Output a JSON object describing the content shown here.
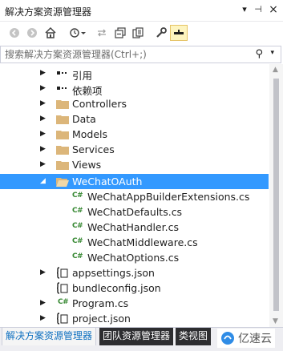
{
  "window": {
    "title": "解决方案资源管理器",
    "controls": {
      "dropdown": "▾",
      "pin": "⊣",
      "close": "×"
    }
  },
  "toolbar": {
    "buttons": [
      {
        "icon": "back-icon",
        "glyph": "◀"
      },
      {
        "icon": "forward-icon",
        "glyph": "▶"
      },
      {
        "icon": "home-icon",
        "glyph": "⌂"
      },
      {
        "icon": "history-icon",
        "glyph": "⏲"
      },
      {
        "icon": "sync-icon",
        "glyph": "⇆"
      },
      {
        "icon": "collapse-all-icon",
        "glyph": "❐"
      },
      {
        "icon": "copy-icon",
        "glyph": "⧉"
      },
      {
        "icon": "properties-icon",
        "glyph": "🔧"
      },
      {
        "icon": "preview-icon",
        "glyph": "▬"
      }
    ]
  },
  "search": {
    "placeholder": "搜索解决方案资源管理器(Ctrl+;)"
  },
  "tree": {
    "items": [
      {
        "label": "引用",
        "type": "references",
        "expander": "▶"
      },
      {
        "label": "依赖项",
        "type": "dependencies",
        "expander": "▶"
      },
      {
        "label": "Controllers",
        "type": "folder",
        "expander": "▶"
      },
      {
        "label": "Data",
        "type": "folder",
        "expander": "▶"
      },
      {
        "label": "Models",
        "type": "folder",
        "expander": "▶"
      },
      {
        "label": "Services",
        "type": "folder",
        "expander": "▶"
      },
      {
        "label": "Views",
        "type": "folder",
        "expander": "▶"
      },
      {
        "label": "WeChatOAuth",
        "type": "folder-open",
        "expander": "◢",
        "selected": true
      },
      {
        "label": "WeChatAppBuilderExtensions.cs",
        "type": "cs"
      },
      {
        "label": "WeChatDefaults.cs",
        "type": "cs"
      },
      {
        "label": "WeChatHandler.cs",
        "type": "cs"
      },
      {
        "label": "WeChatMiddleware.cs",
        "type": "cs"
      },
      {
        "label": "WeChatOptions.cs",
        "type": "cs"
      },
      {
        "label": "appsettings.json",
        "type": "json",
        "expander": "▶"
      },
      {
        "label": "bundleconfig.json",
        "type": "json"
      },
      {
        "label": "Program.cs",
        "type": "cs",
        "expander": "▶"
      },
      {
        "label": "project.json",
        "type": "json",
        "expander": "▶"
      }
    ],
    "cs_glyph": "C#"
  },
  "tabs": [
    {
      "label": "解决方案资源管理器",
      "active": true
    },
    {
      "label": "团队资源管理器",
      "active": false
    },
    {
      "label": "类视图",
      "active": false
    }
  ],
  "watermark": {
    "text": "亿速云"
  },
  "colors": {
    "selection": "#3399ff",
    "folder": "#dcb67a",
    "cs_icon": "#368832",
    "tab_active_text": "#0e70c0"
  }
}
